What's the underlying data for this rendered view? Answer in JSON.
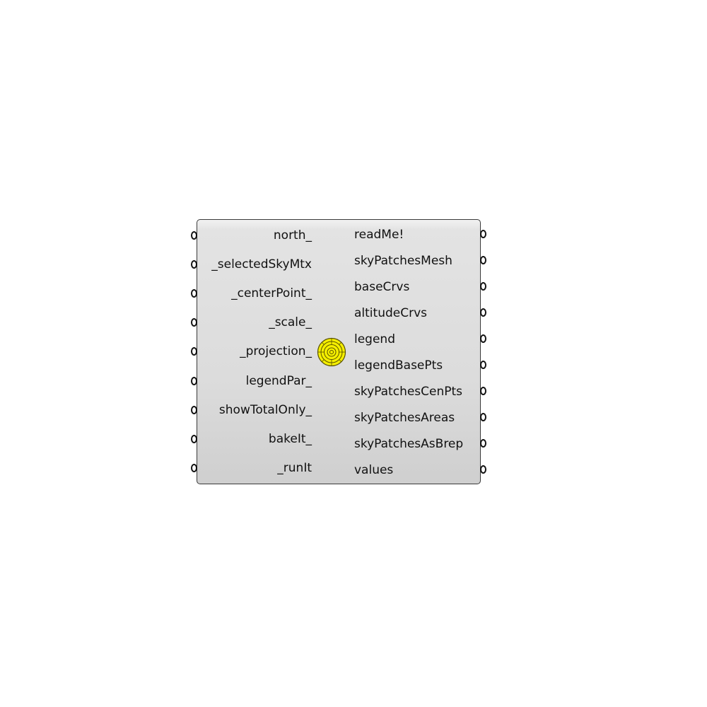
{
  "component": {
    "inputs": [
      {
        "label": "north_"
      },
      {
        "label": "_selectedSkyMtx"
      },
      {
        "label": "_centerPoint_"
      },
      {
        "label": "_scale_"
      },
      {
        "label": "_projection_"
      },
      {
        "label": "legendPar_"
      },
      {
        "label": "showTotalOnly_"
      },
      {
        "label": "bakeIt_"
      },
      {
        "label": "_runIt"
      }
    ],
    "outputs": [
      {
        "label": "readMe!"
      },
      {
        "label": "skyPatchesMesh"
      },
      {
        "label": "baseCrvs"
      },
      {
        "label": "altitudeCrvs"
      },
      {
        "label": "legend"
      },
      {
        "label": "legendBasePts"
      },
      {
        "label": "skyPatchesCenPts"
      },
      {
        "label": "skyPatchesAreas"
      },
      {
        "label": "skyPatchesAsBrep"
      },
      {
        "label": "values"
      }
    ],
    "icon": "sky-dome-icon"
  },
  "colors": {
    "icon_fill": "#f5ef00",
    "icon_stroke": "#5a5200",
    "border": "#3a3a3a",
    "text": "#111111"
  }
}
